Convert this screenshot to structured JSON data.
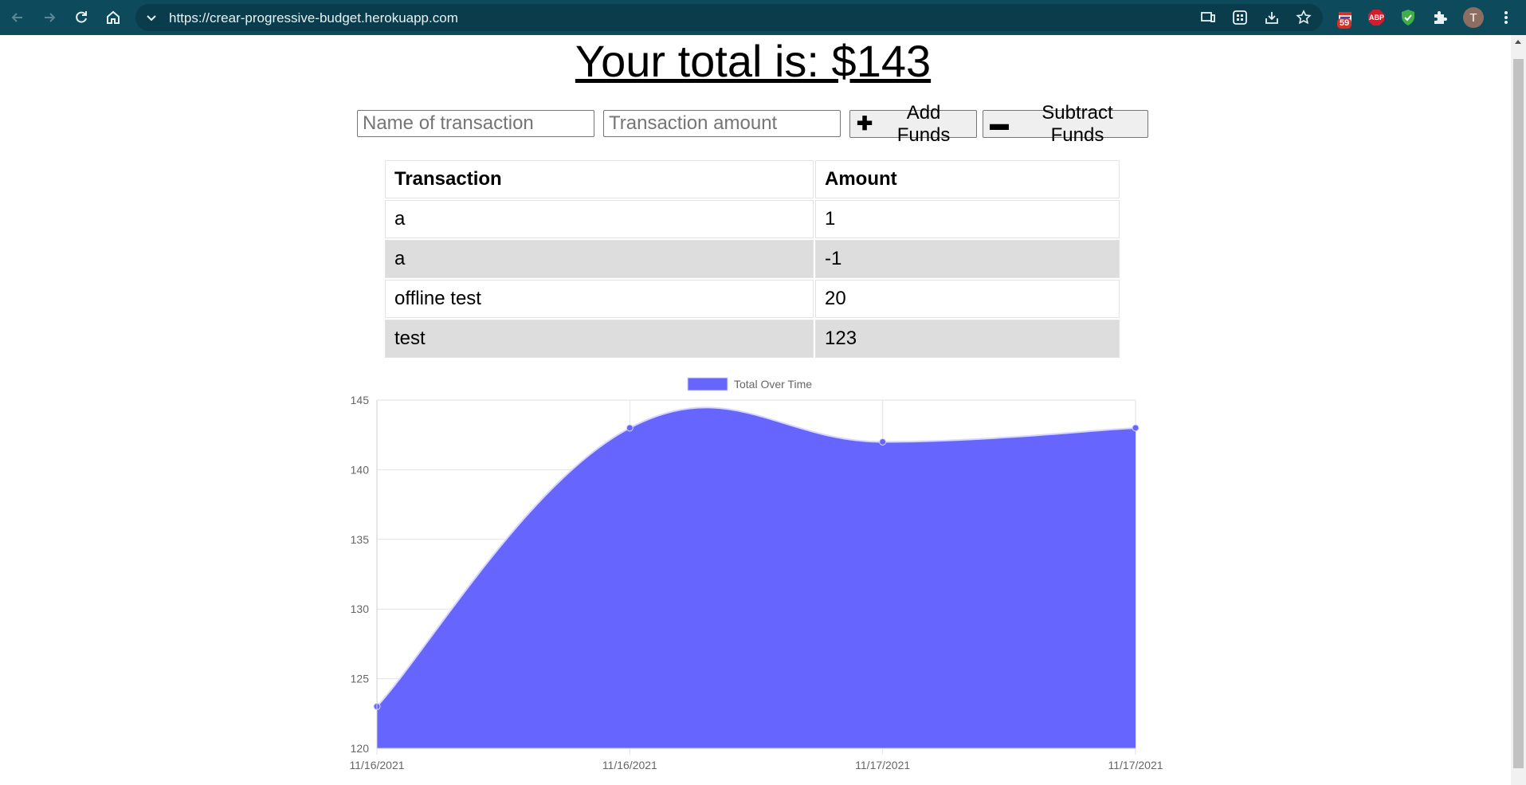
{
  "browser": {
    "url": "https://crear-progressive-budget.herokuapp.com",
    "extension_badge": "59",
    "abp_label": "ABP",
    "avatar_initial": "T"
  },
  "page": {
    "title": "Your total is: $143",
    "name_placeholder": "Name of transaction",
    "amount_placeholder": "Transaction amount",
    "add_label": "Add Funds",
    "subtract_label": "Subtract Funds"
  },
  "table": {
    "headers": [
      "Transaction",
      "Amount"
    ],
    "rows": [
      {
        "name": "a",
        "amount": "1"
      },
      {
        "name": "a",
        "amount": "-1"
      },
      {
        "name": "offline test",
        "amount": "20"
      },
      {
        "name": "test",
        "amount": "123"
      }
    ]
  },
  "chart_data": {
    "type": "area",
    "legend": "Total Over Time",
    "legend_position": "top",
    "x": [
      "11/16/2021",
      "11/16/2021",
      "11/17/2021",
      "11/17/2021"
    ],
    "series": [
      {
        "name": "Total Over Time",
        "values": [
          123,
          143,
          142,
          143
        ],
        "color": "#6666ff"
      }
    ],
    "ylim": [
      120,
      145
    ],
    "yticks": [
      145,
      140,
      135,
      130,
      125,
      120
    ],
    "grid": true
  }
}
